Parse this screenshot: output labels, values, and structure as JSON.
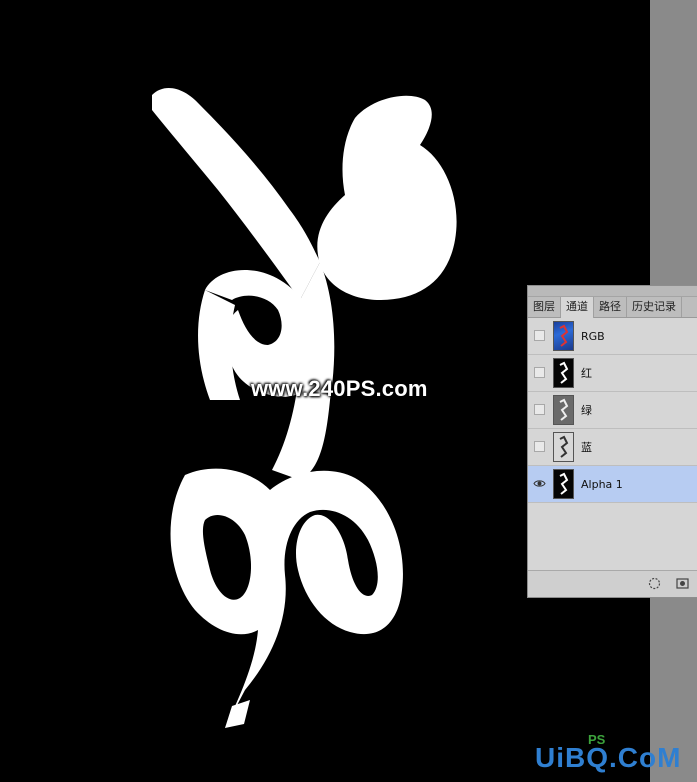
{
  "canvas": {
    "background": "#000000",
    "watermark": "www.240PS.com"
  },
  "channels_panel": {
    "tabs": [
      {
        "label": "图层",
        "active": false
      },
      {
        "label": "通道",
        "active": true
      },
      {
        "label": "路径",
        "active": false
      },
      {
        "label": "历史记录",
        "active": false
      }
    ],
    "channels": [
      {
        "name": "RGB",
        "visible": false,
        "selected": false,
        "thumb": "color"
      },
      {
        "name": "红",
        "visible": false,
        "selected": false,
        "thumb": "dark"
      },
      {
        "name": "绿",
        "visible": false,
        "selected": false,
        "thumb": "gray"
      },
      {
        "name": "蓝",
        "visible": false,
        "selected": false,
        "thumb": "light"
      },
      {
        "name": "Alpha 1",
        "visible": true,
        "selected": true,
        "thumb": "dark"
      }
    ],
    "footer_icons": [
      "load-selection-icon",
      "save-selection-icon"
    ],
    "selection_color": "#b7ccf2"
  },
  "branding": {
    "logo_text": "UiBQ.CoM",
    "logo_ps": "PS",
    "accent": "#2f7fd1"
  }
}
